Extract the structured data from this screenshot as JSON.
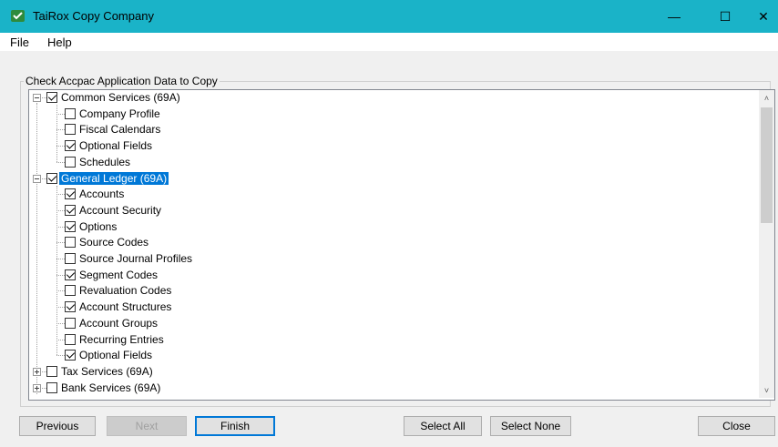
{
  "window": {
    "title": "TaiRox Copy Company",
    "minimize": "—",
    "maximize": "☐",
    "close": "✕"
  },
  "menu": [
    "File",
    "Help"
  ],
  "group_label": "Check Accpac Application Data to Copy",
  "tree": {
    "groups": [
      {
        "label": "Common Services (69A)",
        "checked": true,
        "expanded": true,
        "selected": false,
        "children": [
          {
            "label": "Company Profile",
            "checked": false
          },
          {
            "label": "Fiscal Calendars",
            "checked": false
          },
          {
            "label": "Optional Fields",
            "checked": true
          },
          {
            "label": "Schedules",
            "checked": false
          }
        ]
      },
      {
        "label": "General Ledger (69A)",
        "checked": true,
        "expanded": true,
        "selected": true,
        "children": [
          {
            "label": "Accounts",
            "checked": true
          },
          {
            "label": "Account Security",
            "checked": true
          },
          {
            "label": "Options",
            "checked": true
          },
          {
            "label": "Source Codes",
            "checked": false
          },
          {
            "label": "Source Journal Profiles",
            "checked": false
          },
          {
            "label": "Segment Codes",
            "checked": true
          },
          {
            "label": "Revaluation Codes",
            "checked": false
          },
          {
            "label": "Account Structures",
            "checked": true
          },
          {
            "label": "Account Groups",
            "checked": false
          },
          {
            "label": "Recurring Entries",
            "checked": false
          },
          {
            "label": "Optional Fields",
            "checked": true
          }
        ]
      },
      {
        "label": "Tax Services (69A)",
        "checked": false,
        "expanded": false,
        "selected": false,
        "children": []
      },
      {
        "label": "Bank Services (69A)",
        "checked": false,
        "expanded": false,
        "selected": false,
        "children": []
      }
    ]
  },
  "scrollbar": {
    "up": "˄",
    "down": "˅"
  },
  "buttons": {
    "previous": "Previous",
    "next": "Next",
    "finish": "Finish",
    "select_all": "Select All",
    "select_none": "Select None",
    "close": "Close"
  }
}
